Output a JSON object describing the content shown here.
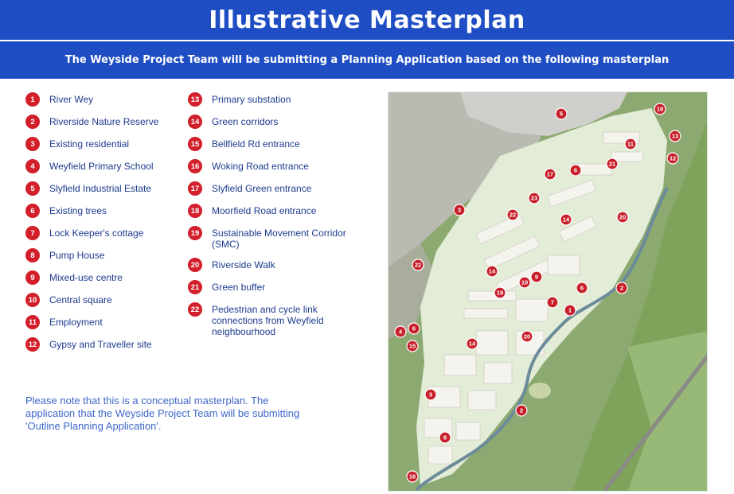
{
  "header": {
    "title": "Illustrative Masterplan",
    "subtitle": "The Weyside Project Team will be submitting a Planning Application based on the following masterplan"
  },
  "legend": {
    "column1": [
      {
        "num": "1",
        "label": "River Wey"
      },
      {
        "num": "2",
        "label": "Riverside Nature Reserve"
      },
      {
        "num": "3",
        "label": "Existing residential"
      },
      {
        "num": "4",
        "label": "Weyfield Primary School"
      },
      {
        "num": "5",
        "label": "Slyfield Industrial Estate"
      },
      {
        "num": "6",
        "label": "Existing trees"
      },
      {
        "num": "7",
        "label": "Lock Keeper's cottage"
      },
      {
        "num": "8",
        "label": "Pump House"
      },
      {
        "num": "9",
        "label": "Mixed-use centre"
      },
      {
        "num": "10",
        "label": "Central square"
      },
      {
        "num": "11",
        "label": "Employment"
      },
      {
        "num": "12",
        "label": "Gypsy and Traveller site"
      }
    ],
    "column2": [
      {
        "num": "13",
        "label": "Primary substation"
      },
      {
        "num": "14",
        "label": "Green corridors"
      },
      {
        "num": "15",
        "label": "Bellfield Rd entrance"
      },
      {
        "num": "16",
        "label": "Woking Road entrance"
      },
      {
        "num": "17",
        "label": "Slyfield Green entrance"
      },
      {
        "num": "18",
        "label": "Moorfield Road entrance"
      },
      {
        "num": "19",
        "label": "Sustainable Movement Corridor (SMC)"
      },
      {
        "num": "20",
        "label": "Riverside Walk"
      },
      {
        "num": "21",
        "label": "Green buffer"
      },
      {
        "num": "22",
        "label": "Pedestrian and cycle link connections from Weyfield neighbourhood"
      }
    ]
  },
  "note": "Please note that this is a conceptual masterplan. The application that the Weyside Project Team will be submitting 'Outline Planning Application'.",
  "map": {
    "markers": [
      "18",
      "5",
      "13",
      "11",
      "12",
      "21",
      "6",
      "17",
      "20",
      "23",
      "14",
      "22",
      "3",
      "22",
      "14",
      "19",
      "9",
      "10",
      "6",
      "7",
      "1",
      "2",
      "4",
      "6",
      "15",
      "20",
      "14",
      "3",
      "2",
      "8",
      "16"
    ]
  },
  "colors": {
    "header_blue": "#1f4ec4",
    "badge_red": "#d21f2a",
    "legend_text": "#1d3b8f",
    "note_text": "#3e66c9"
  }
}
